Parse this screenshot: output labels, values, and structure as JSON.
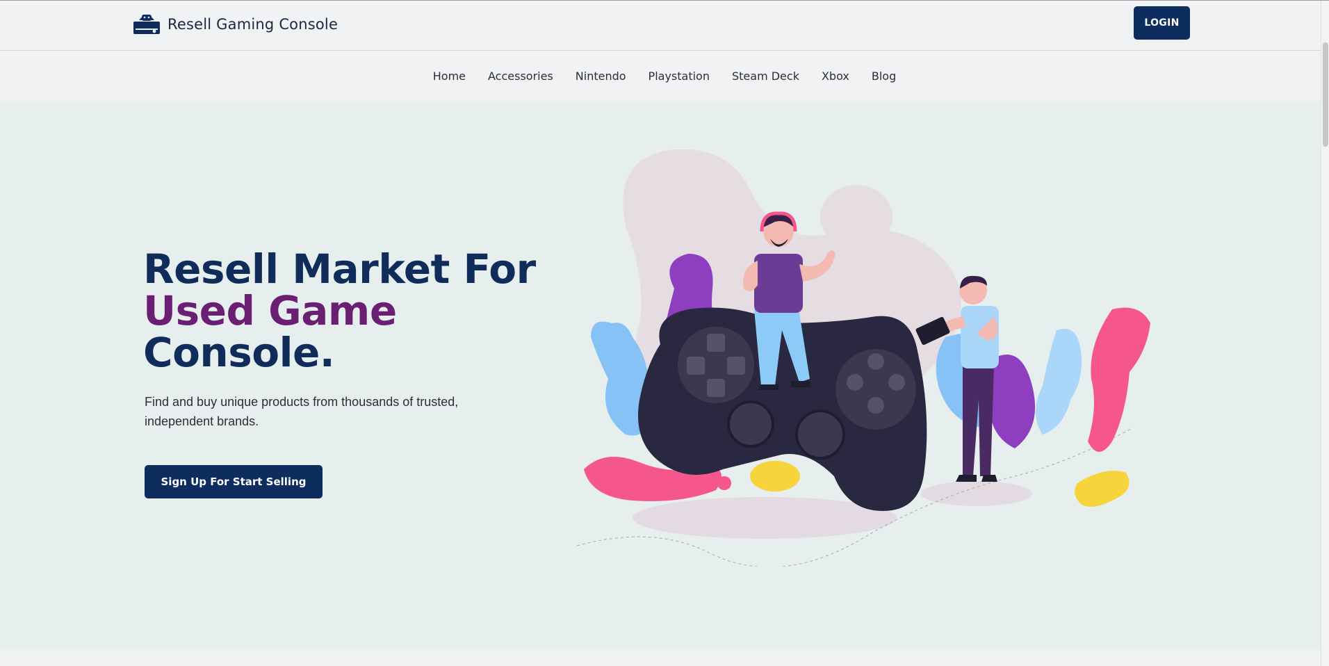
{
  "header": {
    "logo_text": "Resell Gaming Console",
    "login_label": "LOGIN"
  },
  "nav": {
    "items": [
      "Home",
      "Accessories",
      "Nintendo",
      "Playstation",
      "Steam Deck",
      "Xbox",
      "Blog"
    ]
  },
  "hero": {
    "title_line1": "Resell Market For",
    "title_line2": "Used Game",
    "title_line3": "Console.",
    "subtitle": "Find and buy unique products from thousands of trusted, independent brands.",
    "cta_label": "Sign Up For Start Selling"
  },
  "colors": {
    "primary": "#0d2d5e",
    "accent": "#6b1f72",
    "hero_bg": "#e6eeee"
  }
}
